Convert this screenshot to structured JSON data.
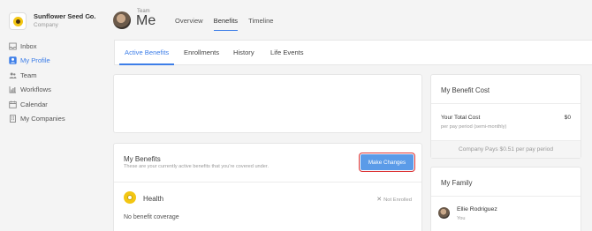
{
  "sidebar": {
    "company_name": "Sunflower Seed Co.",
    "company_sub": "Company",
    "items": [
      {
        "label": "Inbox",
        "icon": "inbox-icon"
      },
      {
        "label": "My Profile",
        "icon": "profile-icon",
        "active": true
      },
      {
        "label": "Team",
        "icon": "team-icon"
      },
      {
        "label": "Workflows",
        "icon": "workflows-icon"
      },
      {
        "label": "Calendar",
        "icon": "calendar-icon"
      },
      {
        "label": "My Companies",
        "icon": "companies-icon"
      }
    ]
  },
  "header": {
    "team_label": "Team",
    "title": "Me",
    "nav": [
      "Overview",
      "Benefits",
      "Timeline"
    ],
    "active_nav": "Benefits"
  },
  "tabs": [
    "Active Benefits",
    "Enrollments",
    "History",
    "Life Events"
  ],
  "benefits": {
    "title": "My Benefits",
    "subtitle": "These are your currently active benefits that you're covered under.",
    "make_changes": "Make Changes",
    "plan": {
      "name": "Health",
      "status": "Not Enrolled",
      "coverage": "No benefit coverage"
    }
  },
  "cost": {
    "title": "My Benefit Cost",
    "total_label": "Your Total Cost",
    "total_value": "$0",
    "period": "per pay period (semi-monthly)",
    "company_pays": "Company Pays $0.51 per pay period"
  },
  "family": {
    "title": "My Family",
    "members": [
      {
        "name": "Ellie Rodriguez",
        "relation": "You"
      }
    ]
  },
  "colors": {
    "accent": "#3d7ee8",
    "button": "#5b9be8",
    "highlight": "#dd3333"
  }
}
